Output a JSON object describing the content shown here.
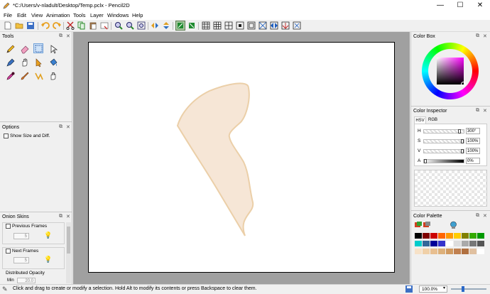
{
  "window": {
    "title": "*C:/Users/v-nladult/Desktop/Temp.pclx - Pencil2D",
    "minimize": "—",
    "maximize": "☐",
    "close": "✕"
  },
  "menu": [
    "File",
    "Edit",
    "View",
    "Animation",
    "Tools",
    "Layer",
    "Windows",
    "Help"
  ],
  "toolbar_icons": [
    "new-file-icon",
    "open-file-icon",
    "save-icon",
    "undo-icon",
    "redo-icon",
    "cut-icon",
    "copy-icon",
    "paste-icon",
    "clear-icon",
    "zoom-in-icon",
    "zoom-out-icon",
    "zoom-fit-icon",
    "flip-horizontal-icon",
    "flip-vertical-icon",
    "onion-prev-icon",
    "onion-next-icon",
    "grid-icon",
    "grid-thirds-icon",
    "grid-cross-icon",
    "grid-center-icon",
    "safe-area-icon",
    "overlay-perspective-1-icon",
    "overlay-perspective-2-icon",
    "overlay-perspective-3-icon",
    "camera-icon"
  ],
  "tools_panel": {
    "title": "Tools",
    "tools": [
      "pencil-icon",
      "eraser-icon",
      "select-icon",
      "pointer-icon",
      "pen-icon",
      "hand-icon",
      "move-icon",
      "bucket-icon",
      "eyedropper-icon",
      "brush-icon",
      "polyline-icon",
      "smudge-icon"
    ]
  },
  "options_panel": {
    "title": "Options",
    "show_size_label": "Show Size and Diff."
  },
  "onion_panel": {
    "title": "Onion Skins",
    "previous_frames": "Previous Frames",
    "next_frames": "Next Frames",
    "prev_value": "5",
    "next_value": "5",
    "distributed_opacity": "Distributed Opacity",
    "min_label": "Min",
    "min_value": "20.0"
  },
  "color_box": {
    "title": "Color Box"
  },
  "color_inspector": {
    "title": "Color Inspector",
    "tab_hsv": "HSV",
    "tab_rgb": "RGB",
    "h_label": "H",
    "s_label": "S",
    "v_label": "V",
    "a_label": "A",
    "h_value": "300°",
    "s_value": "100%",
    "v_value": "100%",
    "a_value": "0%"
  },
  "color_palette": {
    "title": "Color Palette",
    "swatches": [
      "#000000",
      "#7f0000",
      "#cc0000",
      "#ff6600",
      "#ff9900",
      "#ffcc00",
      "#808000",
      "#33aa00",
      "#009900",
      "#00cccc",
      "#336699",
      "#000099",
      "#3333cc",
      "#ffffff",
      "#dddddd",
      "#aaaaaa",
      "#777777",
      "#555555",
      "#f7e2c8",
      "#f0d0a8",
      "#e8bf90",
      "#ddb07a",
      "#d09a60",
      "#c08050",
      "#b07040",
      "#e0c0a0",
      "#ffffff"
    ]
  },
  "status": {
    "message": "Click and drag to create or modify a selection. Hold Alt to modify its contents or press Backspace to clear them.",
    "zoom": "100.0%"
  },
  "colors": {
    "stroke": "#ebcfa8",
    "fill": "#f6e6d6"
  }
}
